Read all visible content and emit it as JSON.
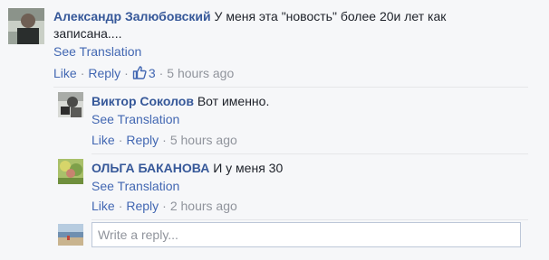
{
  "comment": {
    "author": "Александр Залюбовский",
    "text_line1": "У меня эта \"новость\" более 20и лет как",
    "text_line2": "записана....",
    "see_translation": "See Translation",
    "like": "Like",
    "reply": "Reply",
    "like_count": "3",
    "time": "5 hours ago"
  },
  "replies": [
    {
      "author": "Виктор Соколов",
      "text": "Вот именно.",
      "see_translation": "See Translation",
      "like": "Like",
      "reply": "Reply",
      "time": "5 hours ago"
    },
    {
      "author": "ОЛЬГА БАКАНОВА",
      "text": "И у меня 30",
      "see_translation": "See Translation",
      "like": "Like",
      "reply": "Reply",
      "time": "2 hours ago"
    }
  ],
  "reply_input": {
    "placeholder": "Write a reply..."
  },
  "separator": "·",
  "icons": {
    "like_count_icon": "thumbs-up-icon"
  },
  "colors": {
    "link": "#4267b2",
    "name": "#365899",
    "meta": "#90949c"
  }
}
